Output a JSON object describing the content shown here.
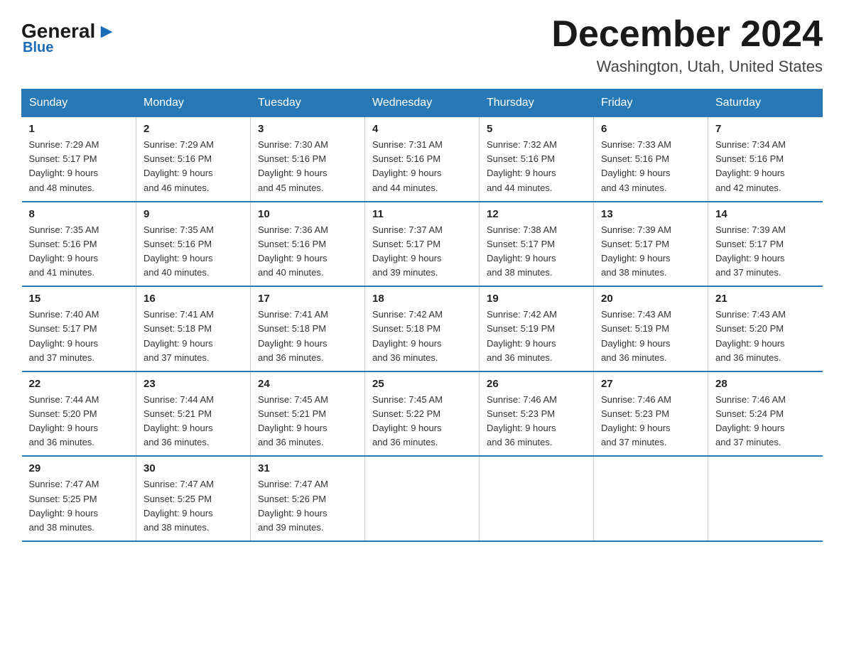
{
  "logo": {
    "general": "General",
    "blue": "Blue"
  },
  "header": {
    "month": "December 2024",
    "location": "Washington, Utah, United States"
  },
  "weekdays": [
    "Sunday",
    "Monday",
    "Tuesday",
    "Wednesday",
    "Thursday",
    "Friday",
    "Saturday"
  ],
  "weeks": [
    [
      {
        "day": "1",
        "sunrise": "7:29 AM",
        "sunset": "5:17 PM",
        "daylight": "9 hours and 48 minutes."
      },
      {
        "day": "2",
        "sunrise": "7:29 AM",
        "sunset": "5:16 PM",
        "daylight": "9 hours and 46 minutes."
      },
      {
        "day": "3",
        "sunrise": "7:30 AM",
        "sunset": "5:16 PM",
        "daylight": "9 hours and 45 minutes."
      },
      {
        "day": "4",
        "sunrise": "7:31 AM",
        "sunset": "5:16 PM",
        "daylight": "9 hours and 44 minutes."
      },
      {
        "day": "5",
        "sunrise": "7:32 AM",
        "sunset": "5:16 PM",
        "daylight": "9 hours and 44 minutes."
      },
      {
        "day": "6",
        "sunrise": "7:33 AM",
        "sunset": "5:16 PM",
        "daylight": "9 hours and 43 minutes."
      },
      {
        "day": "7",
        "sunrise": "7:34 AM",
        "sunset": "5:16 PM",
        "daylight": "9 hours and 42 minutes."
      }
    ],
    [
      {
        "day": "8",
        "sunrise": "7:35 AM",
        "sunset": "5:16 PM",
        "daylight": "9 hours and 41 minutes."
      },
      {
        "day": "9",
        "sunrise": "7:35 AM",
        "sunset": "5:16 PM",
        "daylight": "9 hours and 40 minutes."
      },
      {
        "day": "10",
        "sunrise": "7:36 AM",
        "sunset": "5:16 PM",
        "daylight": "9 hours and 40 minutes."
      },
      {
        "day": "11",
        "sunrise": "7:37 AM",
        "sunset": "5:17 PM",
        "daylight": "9 hours and 39 minutes."
      },
      {
        "day": "12",
        "sunrise": "7:38 AM",
        "sunset": "5:17 PM",
        "daylight": "9 hours and 38 minutes."
      },
      {
        "day": "13",
        "sunrise": "7:39 AM",
        "sunset": "5:17 PM",
        "daylight": "9 hours and 38 minutes."
      },
      {
        "day": "14",
        "sunrise": "7:39 AM",
        "sunset": "5:17 PM",
        "daylight": "9 hours and 37 minutes."
      }
    ],
    [
      {
        "day": "15",
        "sunrise": "7:40 AM",
        "sunset": "5:17 PM",
        "daylight": "9 hours and 37 minutes."
      },
      {
        "day": "16",
        "sunrise": "7:41 AM",
        "sunset": "5:18 PM",
        "daylight": "9 hours and 37 minutes."
      },
      {
        "day": "17",
        "sunrise": "7:41 AM",
        "sunset": "5:18 PM",
        "daylight": "9 hours and 36 minutes."
      },
      {
        "day": "18",
        "sunrise": "7:42 AM",
        "sunset": "5:18 PM",
        "daylight": "9 hours and 36 minutes."
      },
      {
        "day": "19",
        "sunrise": "7:42 AM",
        "sunset": "5:19 PM",
        "daylight": "9 hours and 36 minutes."
      },
      {
        "day": "20",
        "sunrise": "7:43 AM",
        "sunset": "5:19 PM",
        "daylight": "9 hours and 36 minutes."
      },
      {
        "day": "21",
        "sunrise": "7:43 AM",
        "sunset": "5:20 PM",
        "daylight": "9 hours and 36 minutes."
      }
    ],
    [
      {
        "day": "22",
        "sunrise": "7:44 AM",
        "sunset": "5:20 PM",
        "daylight": "9 hours and 36 minutes."
      },
      {
        "day": "23",
        "sunrise": "7:44 AM",
        "sunset": "5:21 PM",
        "daylight": "9 hours and 36 minutes."
      },
      {
        "day": "24",
        "sunrise": "7:45 AM",
        "sunset": "5:21 PM",
        "daylight": "9 hours and 36 minutes."
      },
      {
        "day": "25",
        "sunrise": "7:45 AM",
        "sunset": "5:22 PM",
        "daylight": "9 hours and 36 minutes."
      },
      {
        "day": "26",
        "sunrise": "7:46 AM",
        "sunset": "5:23 PM",
        "daylight": "9 hours and 36 minutes."
      },
      {
        "day": "27",
        "sunrise": "7:46 AM",
        "sunset": "5:23 PM",
        "daylight": "9 hours and 37 minutes."
      },
      {
        "day": "28",
        "sunrise": "7:46 AM",
        "sunset": "5:24 PM",
        "daylight": "9 hours and 37 minutes."
      }
    ],
    [
      {
        "day": "29",
        "sunrise": "7:47 AM",
        "sunset": "5:25 PM",
        "daylight": "9 hours and 38 minutes."
      },
      {
        "day": "30",
        "sunrise": "7:47 AM",
        "sunset": "5:25 PM",
        "daylight": "9 hours and 38 minutes."
      },
      {
        "day": "31",
        "sunrise": "7:47 AM",
        "sunset": "5:26 PM",
        "daylight": "9 hours and 39 minutes."
      },
      null,
      null,
      null,
      null
    ]
  ],
  "labels": {
    "sunrise": "Sunrise:",
    "sunset": "Sunset:",
    "daylight": "Daylight:"
  }
}
